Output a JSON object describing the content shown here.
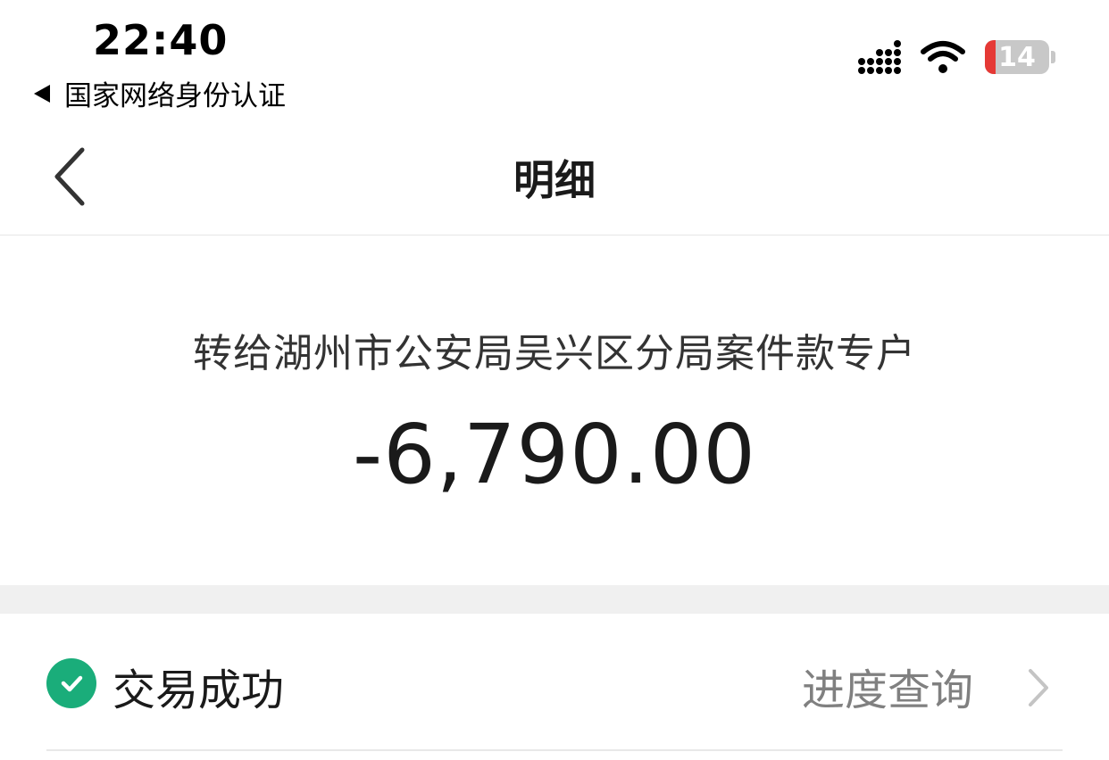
{
  "status_bar": {
    "time": "22:40",
    "back_app": "国家网络身份认证",
    "battery": "14",
    "icons": [
      "signal-icon",
      "wifi-icon",
      "battery-icon"
    ]
  },
  "nav": {
    "title": "明细",
    "back_icon": "chevron-left-icon"
  },
  "transaction": {
    "payee": "转给湖州市公安局吴兴区分局案件款专户",
    "amount": "-6,790.00"
  },
  "status": {
    "label": "交易成功",
    "progress_link": "进度查询",
    "icon": "check-circle-icon"
  },
  "colors": {
    "success": "#1aad7a",
    "battery_low": "#e53935"
  }
}
